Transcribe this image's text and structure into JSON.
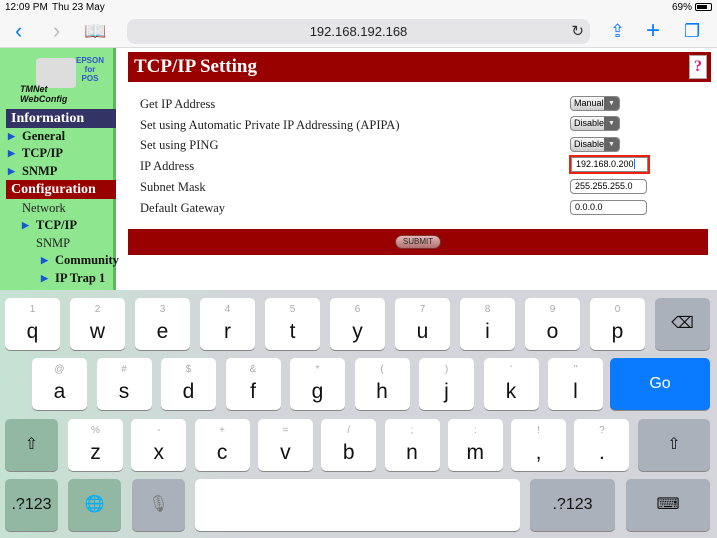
{
  "status": {
    "time": "12:09 PM",
    "date": "Thu 23 May",
    "battery": "69%"
  },
  "browser": {
    "url": "192.168.192.168",
    "icons": [
      "back-icon",
      "forward-icon",
      "bookmarks-icon",
      "reload-icon",
      "share-icon",
      "new-tab-icon",
      "tabs-icon"
    ]
  },
  "sidebar": {
    "logo": {
      "lines": [
        "EPSON",
        "for",
        "POS",
        "TMNet",
        "WebConfig"
      ]
    },
    "info_header": "Information",
    "info_items": [
      "General",
      "TCP/IP",
      "SNMP"
    ],
    "config_header": "Configuration",
    "network": "Network",
    "tcpip": "TCP/IP",
    "snmp": "SNMP",
    "community": "Community",
    "iptrap": "IP Trap 1"
  },
  "main": {
    "title": "TCP/IP Setting",
    "help": "?",
    "fields": [
      {
        "label": "Get IP Address",
        "value": "Manual"
      },
      {
        "label": "Set using Automatic Private IP Addressing (APIPA)",
        "value": "Disable"
      },
      {
        "label": "Set using PING",
        "value": "Disable"
      },
      {
        "label": "IP Address",
        "value": "192.168.0.200"
      },
      {
        "label": "Subnet Mask",
        "value": "255.255.255.0"
      },
      {
        "label": "Default Gateway",
        "value": "0.0.0.0"
      }
    ],
    "submit": "SUBMIT"
  },
  "keyboard": {
    "row1": [
      [
        "1",
        "q"
      ],
      [
        "2",
        "w"
      ],
      [
        "3",
        "e"
      ],
      [
        "4",
        "r"
      ],
      [
        "5",
        "t"
      ],
      [
        "6",
        "y"
      ],
      [
        "7",
        "u"
      ],
      [
        "8",
        "i"
      ],
      [
        "9",
        "o"
      ],
      [
        "0",
        "p"
      ]
    ],
    "row2": [
      [
        "@",
        "a"
      ],
      [
        "#",
        "s"
      ],
      [
        "$",
        "d"
      ],
      [
        "&",
        "f"
      ],
      [
        "*",
        "g"
      ],
      [
        "(",
        "h"
      ],
      [
        ")",
        "j"
      ],
      [
        "'",
        "k"
      ],
      [
        "\"",
        "l"
      ]
    ],
    "row3": [
      [
        "%",
        "z"
      ],
      [
        "-",
        "x"
      ],
      [
        "+",
        "c"
      ],
      [
        "=",
        "v"
      ],
      [
        "/",
        "b"
      ],
      [
        ";",
        "n"
      ],
      [
        ":",
        "m"
      ],
      [
        "!",
        ","
      ],
      [
        "?",
        "."
      ]
    ],
    "go": "Go",
    "numbers": ".?123",
    "accent": "#0a7aff"
  }
}
